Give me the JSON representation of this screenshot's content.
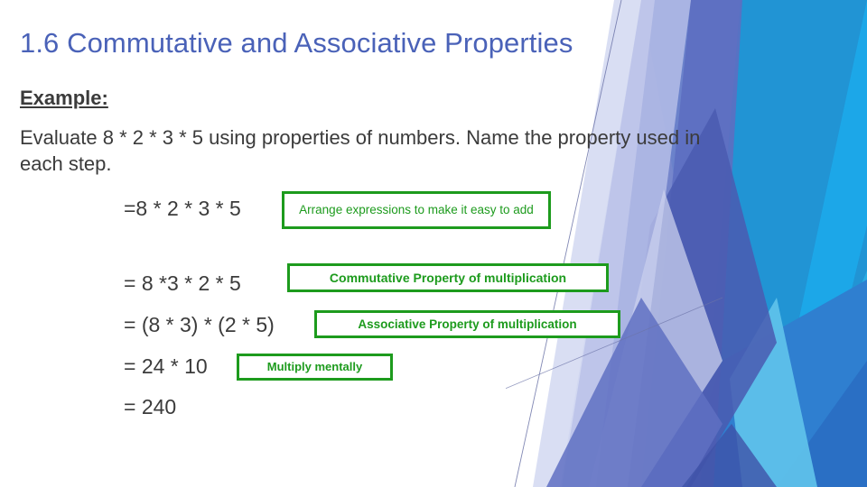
{
  "slide": {
    "title": "1.6 Commutative and Associative Properties",
    "example_label": "Example:",
    "prompt": "Evaluate 8 * 2 * 3 * 5 using properties of numbers. Name the property used in each step.",
    "steps": [
      {
        "equation": "=8 * 2 * 3 * 5",
        "note": "Arrange expressions to make it easy to add"
      },
      {
        "equation": "= 8 *3 * 2 * 5",
        "note": "Commutative Property of multiplication"
      },
      {
        "equation": "= (8 * 3) * (2 * 5)",
        "note": "Associative Property of multiplication"
      },
      {
        "equation": "= 24 * 10",
        "note": "Multiply mentally"
      },
      {
        "equation": "= 240",
        "note": ""
      }
    ]
  },
  "colors": {
    "title": "#4a62b8",
    "body_text": "#3b3b3b",
    "callout_green": "#1d9b1d",
    "background": "#ffffff",
    "decor_cyan": "#29abe2",
    "decor_cyan_light": "#5fc2ea",
    "decor_blue": "#2f7fd0",
    "decor_blue_dark": "#2a6fc4",
    "decor_periwinkle": "#6f7fc9",
    "decor_periwinkle_dark": "#4a5bb0",
    "decor_lavender": "#b9c1e8",
    "decor_lavender_light": "#d7dcf2",
    "decor_hairline": "#6c74a8"
  }
}
